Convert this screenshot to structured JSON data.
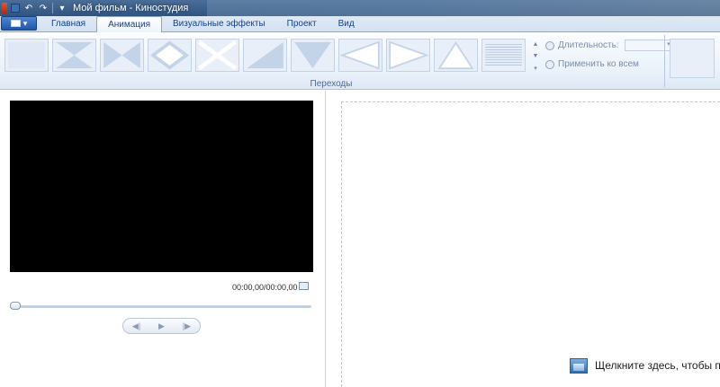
{
  "window": {
    "title": "Мой фильм - Киностудия"
  },
  "tabs": [
    {
      "label": "Главная",
      "active": false
    },
    {
      "label": "Анимация",
      "active": true
    },
    {
      "label": "Визуальные эффекты",
      "active": false
    },
    {
      "label": "Проект",
      "active": false
    },
    {
      "label": "Вид",
      "active": false
    }
  ],
  "ribbon": {
    "transitions_group_label": "Переходы",
    "duration_label": "Длительность:",
    "duration_value": "",
    "apply_all_label": "Применить ко всем"
  },
  "preview": {
    "time": "00:00,00/00:00,00",
    "seek_progress": 0
  },
  "storyboard": {
    "hint": "Щелкните здесь, чтобы пр"
  },
  "colors": {
    "title_bar": "#2f5480",
    "ribbon_bg": "#e9f1fa",
    "video_bg": "#000000",
    "accent": "#15428b"
  }
}
